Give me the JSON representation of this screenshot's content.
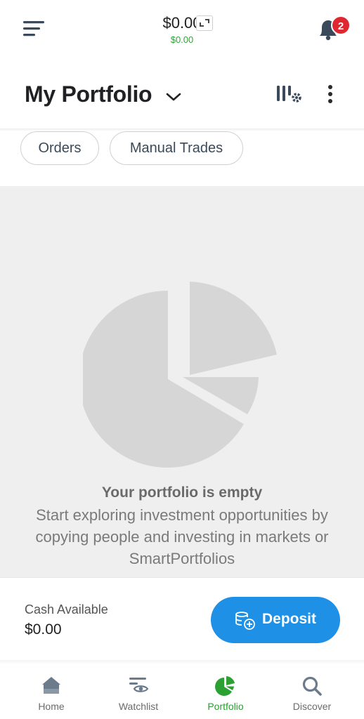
{
  "header": {
    "balance": "$0.00",
    "balance_change": "$0.00",
    "notification_count": "2"
  },
  "page": {
    "title": "My Portfolio"
  },
  "filters": [
    {
      "label": "Orders"
    },
    {
      "label": "Manual Trades"
    }
  ],
  "empty_state": {
    "title": "Your portfolio is empty",
    "message": "Start exploring investment opportunities by copying people and investing in markets or SmartPortfolios"
  },
  "cash": {
    "label": "Cash Available",
    "value": "$0.00",
    "deposit_label": "Deposit"
  },
  "nav": [
    {
      "label": "Home",
      "icon": "home-icon"
    },
    {
      "label": "Watchlist",
      "icon": "watchlist-icon"
    },
    {
      "label": "Portfolio",
      "icon": "portfolio-pie-icon",
      "active": true
    },
    {
      "label": "Discover",
      "icon": "search-icon"
    }
  ],
  "colors": {
    "accent_green": "#2ca033",
    "deposit_blue": "#1e90e6",
    "badge_red": "#e0262e",
    "empty_bg": "#efefef"
  }
}
